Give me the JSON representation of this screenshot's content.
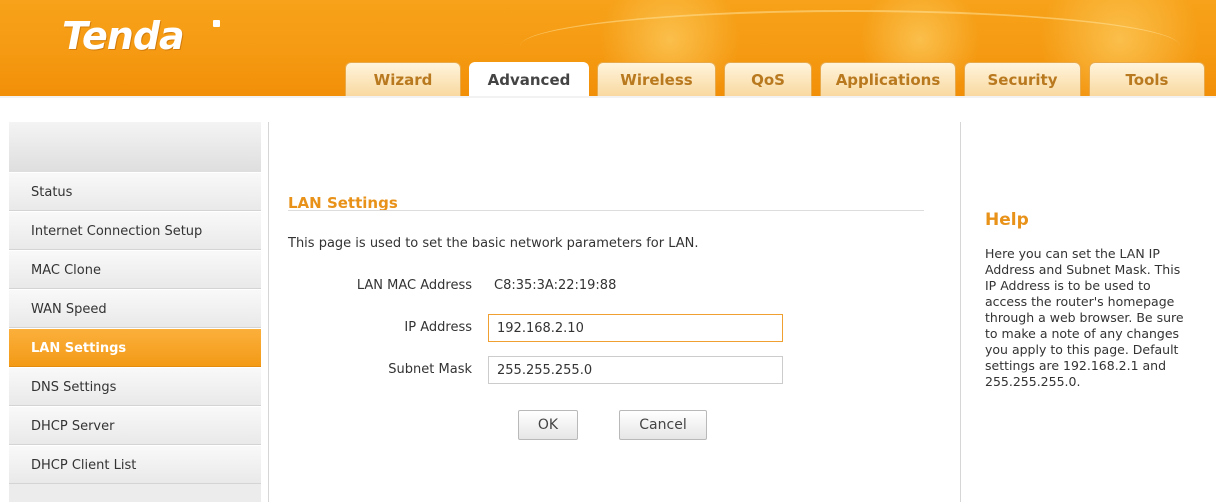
{
  "brand": {
    "logo": "Tenda"
  },
  "nav": {
    "tabs": [
      {
        "label": "Wizard"
      },
      {
        "label": "Advanced"
      },
      {
        "label": "Wireless"
      },
      {
        "label": "QoS"
      },
      {
        "label": "Applications"
      },
      {
        "label": "Security"
      },
      {
        "label": "Tools"
      }
    ],
    "active": "Advanced"
  },
  "sidebar": {
    "items": [
      {
        "label": "Status"
      },
      {
        "label": "Internet Connection Setup"
      },
      {
        "label": "MAC Clone"
      },
      {
        "label": "WAN Speed"
      },
      {
        "label": "LAN Settings"
      },
      {
        "label": "DNS Settings"
      },
      {
        "label": "DHCP Server"
      },
      {
        "label": "DHCP Client List"
      }
    ],
    "active": "LAN Settings"
  },
  "main": {
    "title": "LAN Settings",
    "description": "This page is used to set the basic network parameters for LAN.",
    "mac_label": "LAN MAC Address",
    "mac_value": "C8:35:3A:22:19:88",
    "ip_label": "IP Address",
    "ip_value": "192.168.2.10",
    "mask_label": "Subnet Mask",
    "mask_value": "255.255.255.0",
    "ok_label": "OK",
    "cancel_label": "Cancel"
  },
  "help": {
    "title": "Help",
    "text": "Here you can set the LAN IP Address and Subnet Mask. This IP Address is to be used to access the router's homepage through a web browser. Be sure to make a note of any changes you apply to this page. Default settings are 192.168.2.1 and 255.255.255.0."
  },
  "colors": {
    "accent": "#f39a16",
    "title": "#e8921a",
    "header": "#f59a12"
  }
}
